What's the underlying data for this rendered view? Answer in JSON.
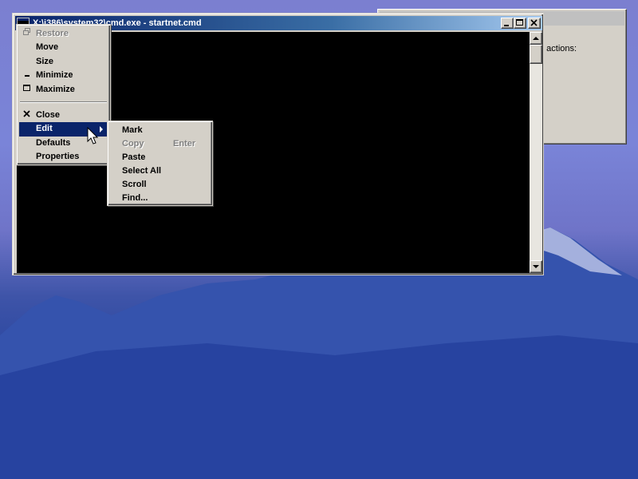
{
  "background_dialog": {
    "visible_text": "g actions:"
  },
  "console": {
    "title": "X:\\i386\\system32\\cmd.exe - startnet.cmd",
    "buttons": {
      "minimize_icon": "minimize-icon",
      "maximize_icon": "maximize-icon",
      "close_icon": "close-icon"
    }
  },
  "system_menu": {
    "items": [
      {
        "label": "Restore",
        "icon": "restore-icon",
        "disabled": true
      },
      {
        "label": "Move",
        "disabled": false
      },
      {
        "label": "Size",
        "disabled": false
      },
      {
        "label": "Minimize",
        "icon": "minimize-icon",
        "disabled": false
      },
      {
        "label": "Maximize",
        "icon": "maximize-icon",
        "disabled": false
      },
      {
        "label": "Close",
        "icon": "close-icon",
        "disabled": false
      },
      {
        "label": "Edit",
        "highlighted": true,
        "has_submenu": true
      },
      {
        "label": "Defaults",
        "disabled": false
      },
      {
        "label": "Properties",
        "disabled": false
      }
    ]
  },
  "edit_menu": {
    "items": [
      {
        "label": "Mark",
        "disabled": false
      },
      {
        "label": "Copy",
        "shortcut": "Enter",
        "disabled": true
      },
      {
        "label": "Paste",
        "disabled": false
      },
      {
        "label": "Select All",
        "disabled": false
      },
      {
        "label": "Scroll",
        "disabled": false
      },
      {
        "label": "Find...",
        "disabled": false
      }
    ]
  },
  "colors": {
    "titlebar_start": "#0a246a",
    "titlebar_end": "#a6caf0",
    "menu_bg": "#d4d0c8",
    "highlight": "#0a246a",
    "terminal_bg": "#000000"
  }
}
